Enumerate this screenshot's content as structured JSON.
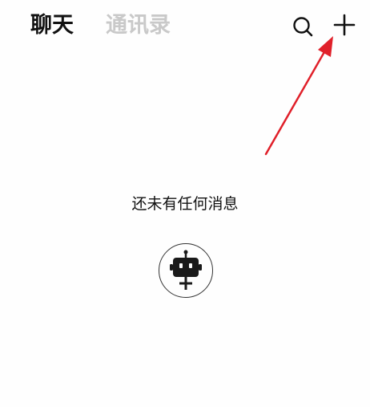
{
  "header": {
    "tabs": [
      {
        "label": "聊天",
        "active": true
      },
      {
        "label": "通讯录",
        "active": false
      }
    ],
    "actions": [
      {
        "icon": "search-icon"
      },
      {
        "icon": "plus-icon"
      }
    ]
  },
  "main": {
    "empty_message": "还未有任何消息",
    "add_bot_icon": "robot-add-icon"
  },
  "annotation": {
    "type": "arrow",
    "color": "#e0202a"
  }
}
